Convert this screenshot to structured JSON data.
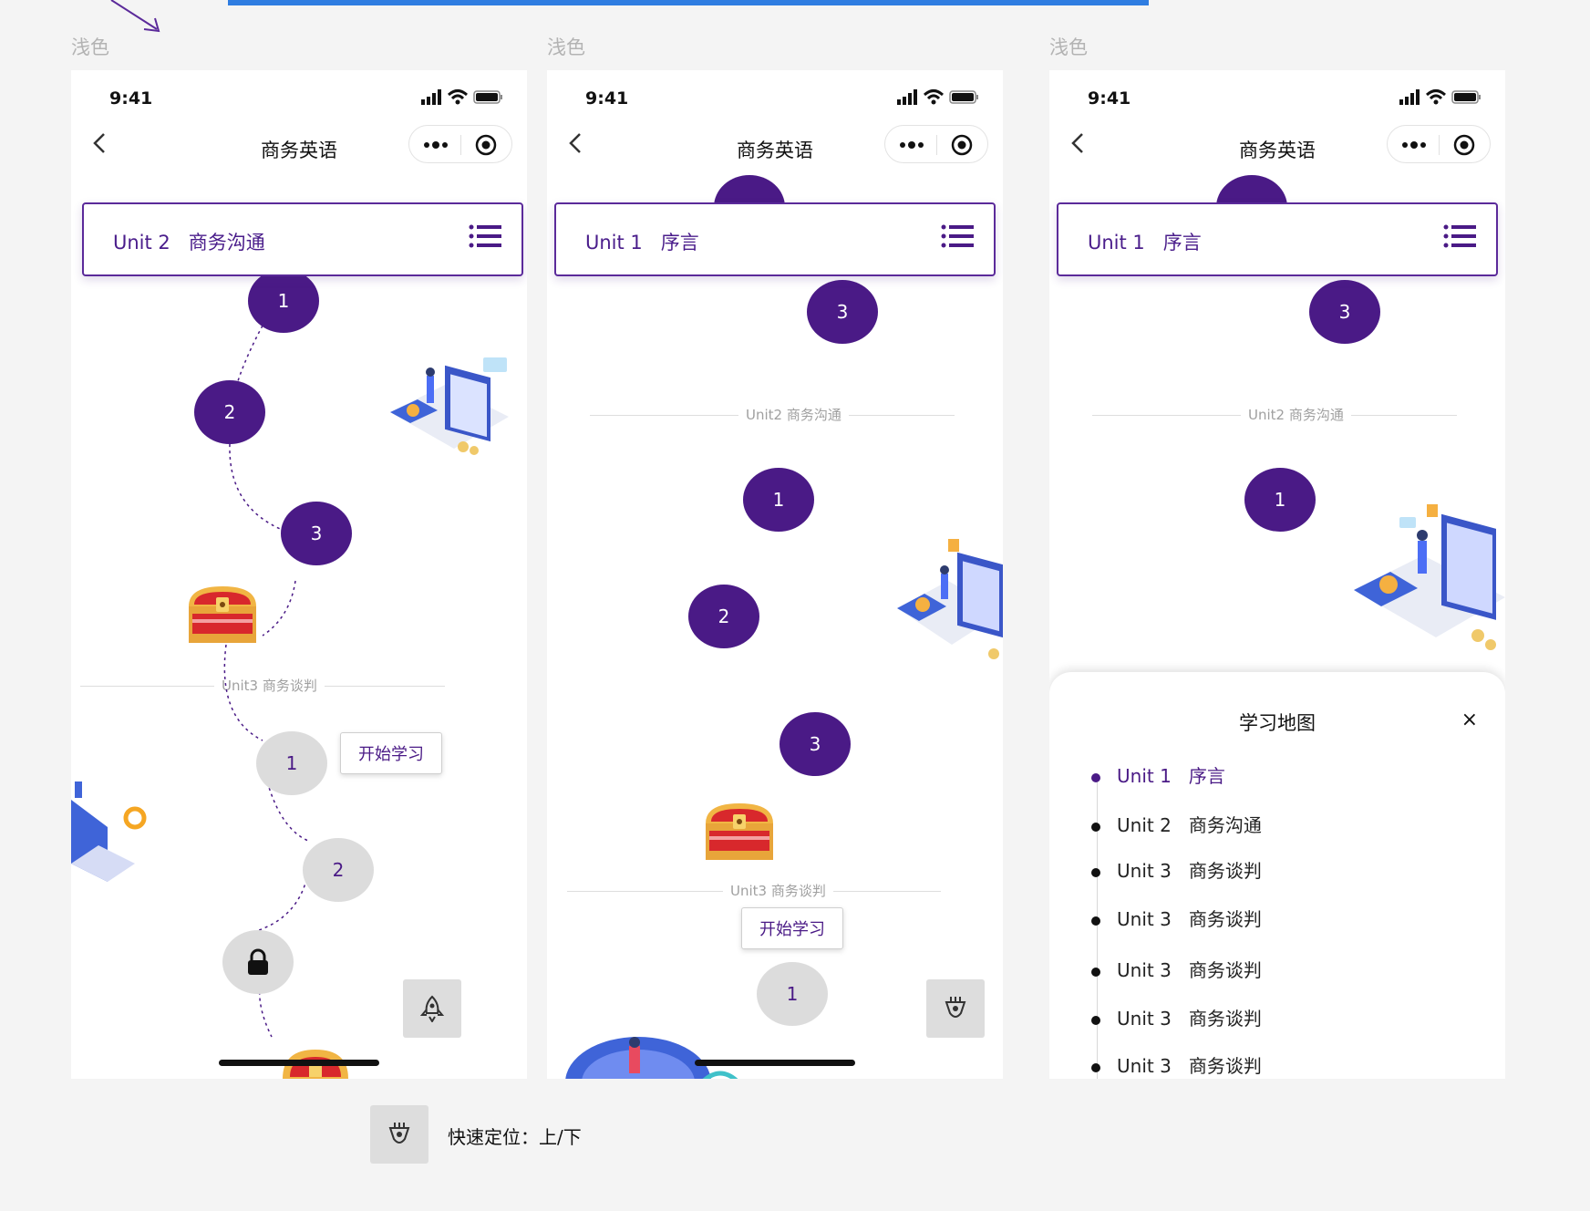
{
  "labels": {
    "light": "浅色"
  },
  "status_time": "9:41",
  "nav_title": "商务英语",
  "phone1": {
    "header": "Unit 2   商务沟通",
    "nodes": [
      "1",
      "2",
      "3"
    ],
    "divider": "Unit3 商务谈判",
    "next_nodes": [
      "1",
      "2"
    ],
    "tooltip": "开始学习"
  },
  "phone2": {
    "header": "Unit 1   序言",
    "top_node": "3",
    "divider1": "Unit2 商务沟通",
    "nodes": [
      "1",
      "2",
      "3"
    ],
    "divider2": "Unit3 商务谈判",
    "tooltip": "开始学习",
    "next_node": "1"
  },
  "phone3": {
    "header": "Unit 1   序言",
    "top_node": "3",
    "divider1": "Unit2 商务沟通",
    "node": "1",
    "sheet": {
      "title": "学习地图",
      "close": "×",
      "items": [
        "Unit 1   序言",
        "Unit 2   商务沟通",
        "Unit 3   商务谈判",
        "Unit 3   商务谈判",
        "Unit 3   商务谈判",
        "Unit 3   商务谈判",
        "Unit 3   商务谈判"
      ]
    }
  },
  "legend": {
    "text": "快速定位：上/下"
  },
  "colors": {
    "accent": "#4a1a86",
    "inactive": "#dcdcdc",
    "background": "#f4f4f4"
  },
  "icons": [
    "signal-icon",
    "wifi-icon",
    "battery-icon",
    "back-icon",
    "more-icon",
    "target-icon",
    "list-icon",
    "lock-icon",
    "rocket-icon",
    "locate-icon",
    "treasure-chest-icon"
  ]
}
